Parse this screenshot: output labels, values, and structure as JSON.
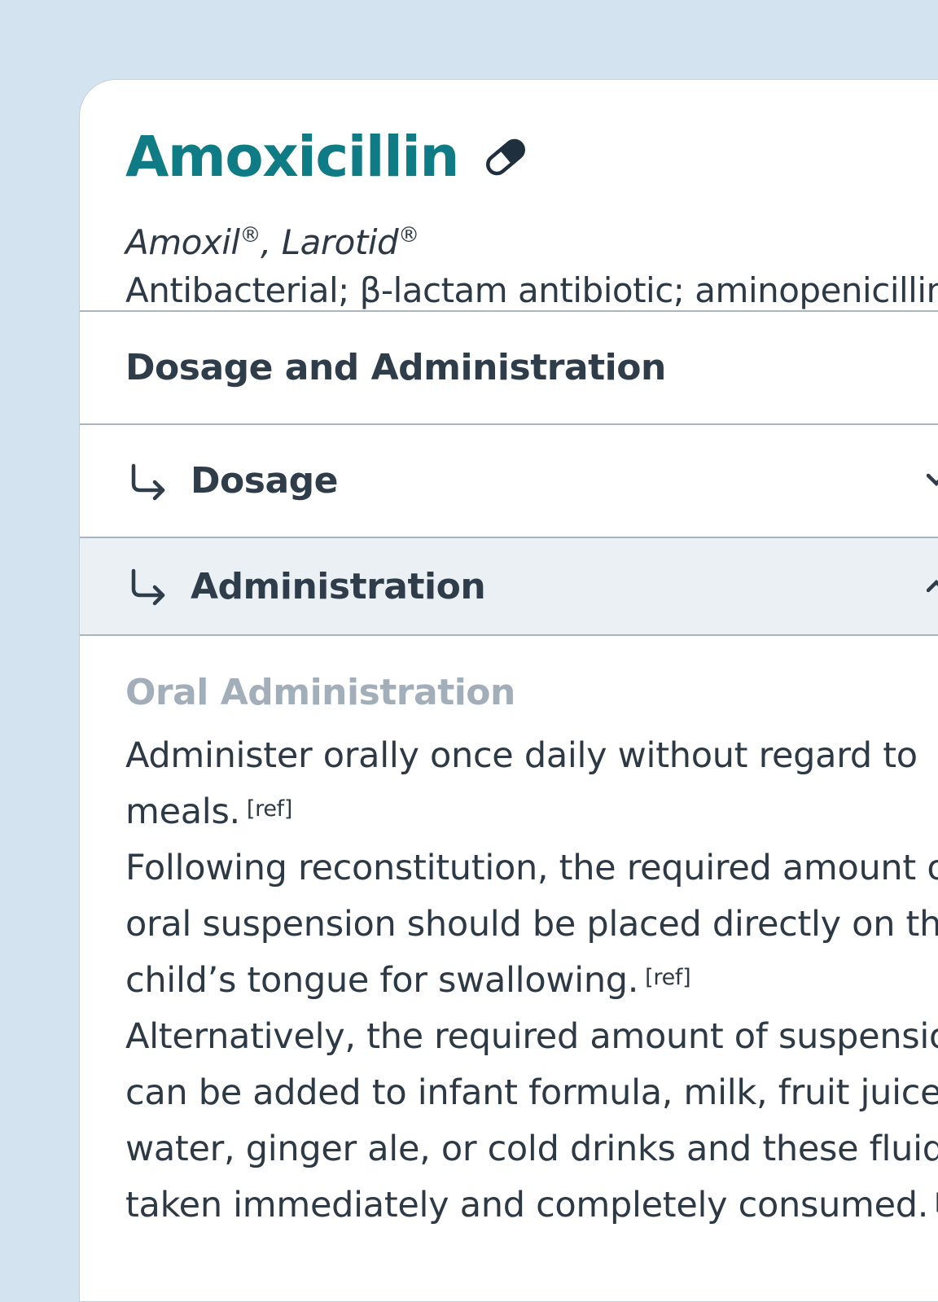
{
  "drug": {
    "name": "Amoxicillin",
    "icon": "pill-icon",
    "brand_1": "Amoxil",
    "brand_sep": ", ",
    "brand_2": "Larotid",
    "reg_mark": "®",
    "classification": "Antibacterial; β-lactam antibiotic; aminopenicillin"
  },
  "section": {
    "title": "Dosage and Administration"
  },
  "accordion": [
    {
      "label": "Dosage",
      "icon": "return-arrow-icon",
      "state": "collapsed",
      "chevron": "chevron-down-icon"
    },
    {
      "label": "Administration",
      "icon": "return-arrow-icon",
      "state": "expanded",
      "chevron": "chevron-up-icon"
    }
  ],
  "content": {
    "subheading": "Oral Administration",
    "lines": [
      "Administer orally once daily without regard to",
      "meals.",
      "Following reconstitution, the required amount of",
      "oral suspension should be placed directly on the",
      "child’s tongue for swallowing.",
      "Alternatively, the required amount of suspension",
      "can be added to infant formula, milk, fruit juice,",
      "water, ginger ale, or cold drinks and these fluids",
      "taken immediately and completely consumed."
    ],
    "ref_label": "[ref]"
  },
  "colors": {
    "background": "#d3e4f0",
    "title": "#0f7b84",
    "text": "#2d3a46",
    "subheading": "#a2afba",
    "expanded_row": "#eaf0f4"
  }
}
